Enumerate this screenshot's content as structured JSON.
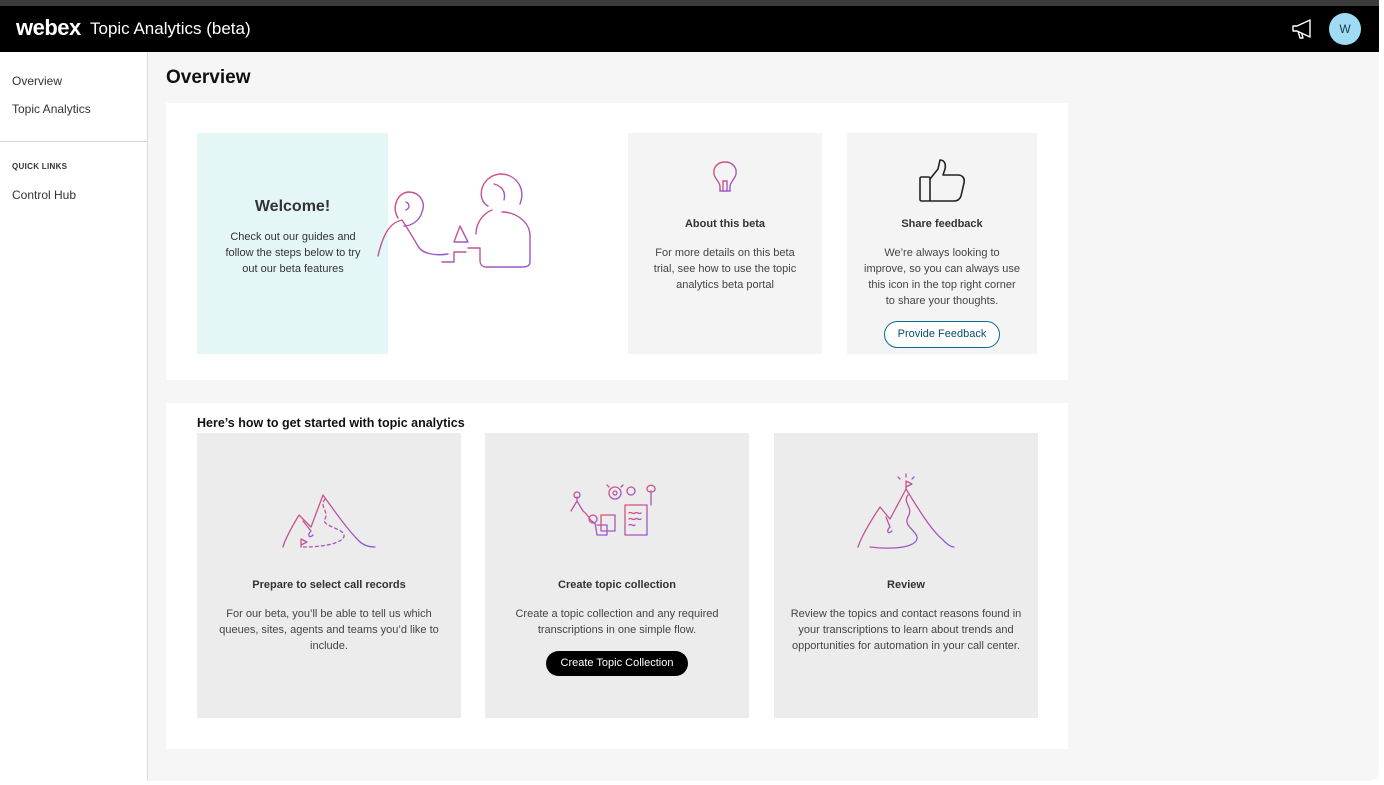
{
  "header": {
    "brand": "webex",
    "app_title": "Topic Analytics (beta)",
    "feedback_icon": "megaphone-icon",
    "avatar_initial": "W",
    "colors": {
      "bar": "#000000",
      "avatar": "#9fdcf4"
    }
  },
  "sidebar": {
    "items": [
      {
        "label": "Overview"
      },
      {
        "label": "Topic Analytics"
      }
    ],
    "quick_links_heading": "QUICK LINKS",
    "quick_links": [
      {
        "label": "Control Hub"
      }
    ]
  },
  "main": {
    "title": "Overview",
    "welcome": {
      "heading": "Welcome!",
      "body": "Check out our guides and follow the steps below to try out our beta features",
      "color": "#e4f7f6"
    },
    "about": {
      "icon": "lightbulb-icon",
      "heading": "About this beta",
      "body": "For more details on this beta trial, see how to use the topic analytics beta portal"
    },
    "share": {
      "icon": "thumbs-up-icon",
      "heading": "Share feedback",
      "body": "We’re always looking to improve, so you can always use this icon in the top right corner to share your thoughts.",
      "button": "Provide Feedback"
    },
    "getting_started": {
      "heading": "Here’s how to get started with topic analytics",
      "steps": [
        {
          "icon": "mountain-path-icon",
          "heading": "Prepare to select call records",
          "body": "For our beta, you’ll be able to tell us which queues, sites, agents and teams you’d like to include."
        },
        {
          "icon": "workbench-tools-icon",
          "heading": "Create topic collection",
          "body": "Create a topic collection and any required transcriptions in one simple flow.",
          "button": "Create Topic Collection"
        },
        {
          "icon": "mountain-flag-icon",
          "heading": "Review",
          "body": "Review the topics and contact reasons found in your transcriptions to learn about trends and opportunities for automation in your call center."
        }
      ]
    }
  }
}
